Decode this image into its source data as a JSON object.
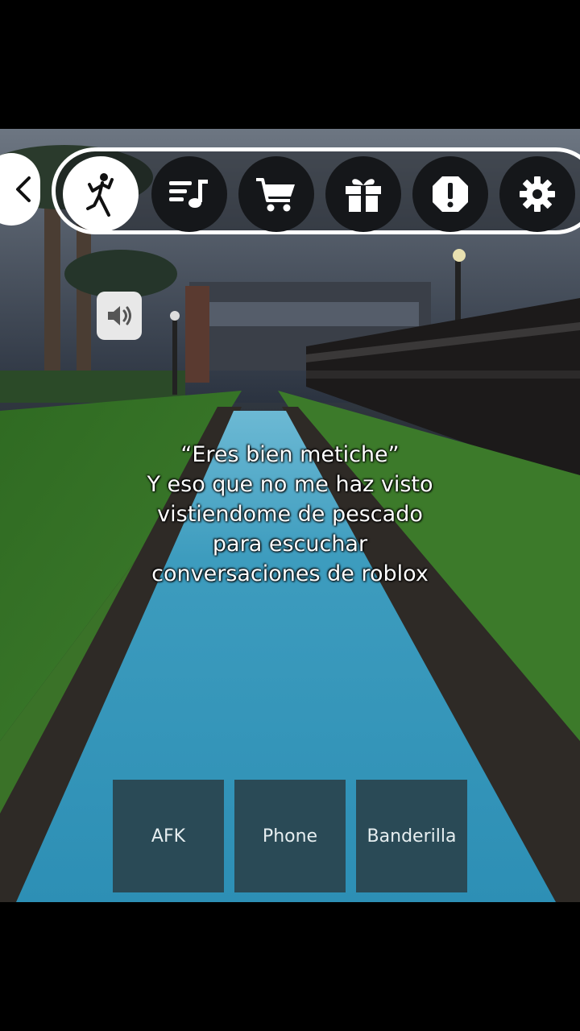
{
  "toolbar": {
    "back_icon": "chevron-left-icon",
    "items": [
      {
        "icon": "emote-dance-icon",
        "active": true
      },
      {
        "icon": "playlist-music-icon",
        "active": false
      },
      {
        "icon": "shopping-cart-icon",
        "active": false
      },
      {
        "icon": "gift-icon",
        "active": false
      },
      {
        "icon": "report-alert-icon",
        "active": false
      },
      {
        "icon": "gear-icon",
        "active": false
      }
    ]
  },
  "caption": {
    "lines": [
      "“Eres bien metiche”",
      "Y eso que no me haz visto",
      "vistiendome de pescado",
      "para escuchar",
      "conversaciones de roblox"
    ]
  },
  "emotes": {
    "afk": "AFK",
    "phone": "Phone",
    "banderilla": "Banderilla"
  },
  "colors": {
    "water": "#2f8fb0",
    "grass": "#3d7a2a",
    "button_bg": "#2a4a56"
  }
}
